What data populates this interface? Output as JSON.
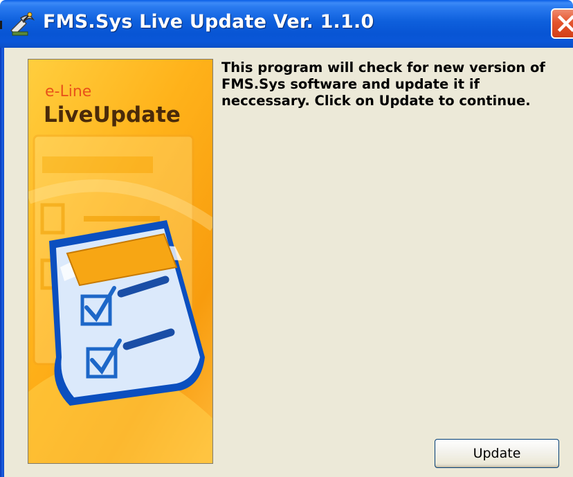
{
  "window": {
    "title": "FMS.Sys Live Update Ver. 1.1.0",
    "app_icon": "satellite-dish-icon",
    "close_icon": "close-icon"
  },
  "banner": {
    "brand_small": "e-Line",
    "brand_big": "LiveUpdate",
    "illustration": "checklist-clipboard-icon"
  },
  "message": {
    "text": "This program will check for new version of FMS.Sys software and update it if neccessary. Click on Update to continue."
  },
  "actions": {
    "update_label": "Update"
  },
  "colors": {
    "titlebar": "#0a56d8",
    "client_background": "#ece9d8",
    "close_button": "#e4552e",
    "banner_orange": "#ffb21a",
    "brand_small": "#e8521a",
    "brand_big": "#4a2a0a"
  }
}
